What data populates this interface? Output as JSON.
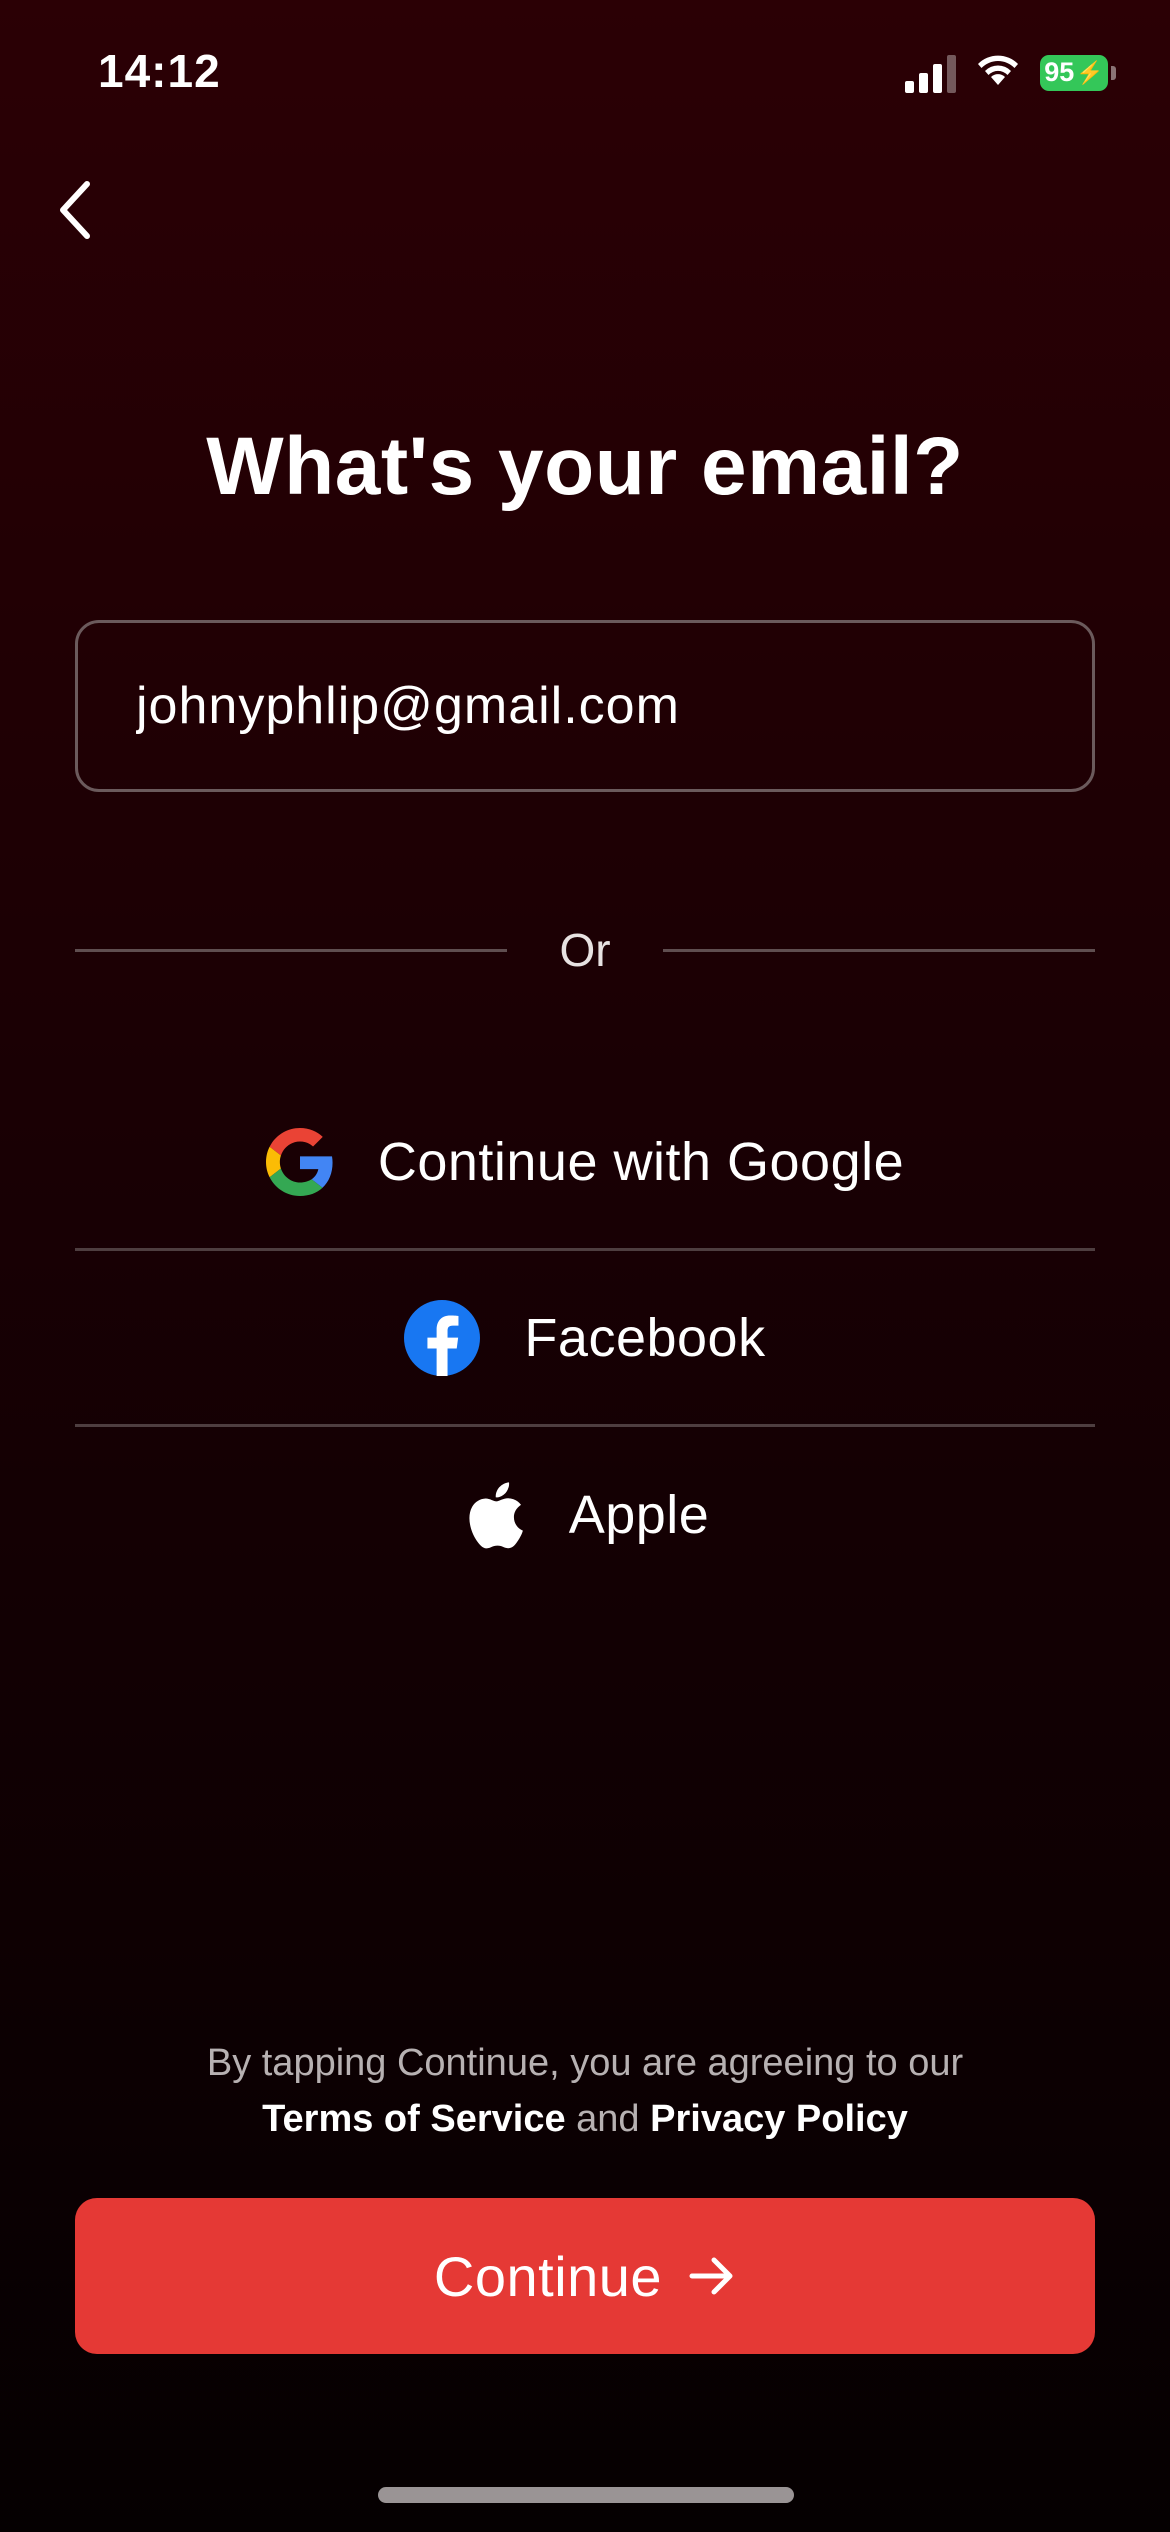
{
  "status_bar": {
    "time": "14:12",
    "battery": "95",
    "signal_icon": "cellular-signal-icon",
    "wifi_icon": "wifi-icon",
    "charging_icon": "charging-bolt-icon"
  },
  "nav": {
    "back_icon": "chevron-left-icon"
  },
  "title": "What's your email?",
  "email": {
    "value": "johnyphlip@gmail.com"
  },
  "divider": {
    "label": "Or"
  },
  "social": [
    {
      "label": "Continue with Google",
      "icon": "google-logo-icon"
    },
    {
      "label": "Facebook",
      "icon": "facebook-logo-icon"
    },
    {
      "label": "Apple",
      "icon": "apple-logo-icon"
    }
  ],
  "terms": {
    "prefix": "By tapping Continue, you are agreeing to our",
    "terms_link": "Terms of Service",
    "conjunction": "and",
    "privacy_link": "Privacy Policy"
  },
  "continue_button": {
    "label": "Continue",
    "icon": "arrow-right-icon"
  },
  "colors": {
    "accent": "#e53935",
    "background_top": "#2b0005",
    "background_bottom": "#050001",
    "battery": "#34c759"
  }
}
